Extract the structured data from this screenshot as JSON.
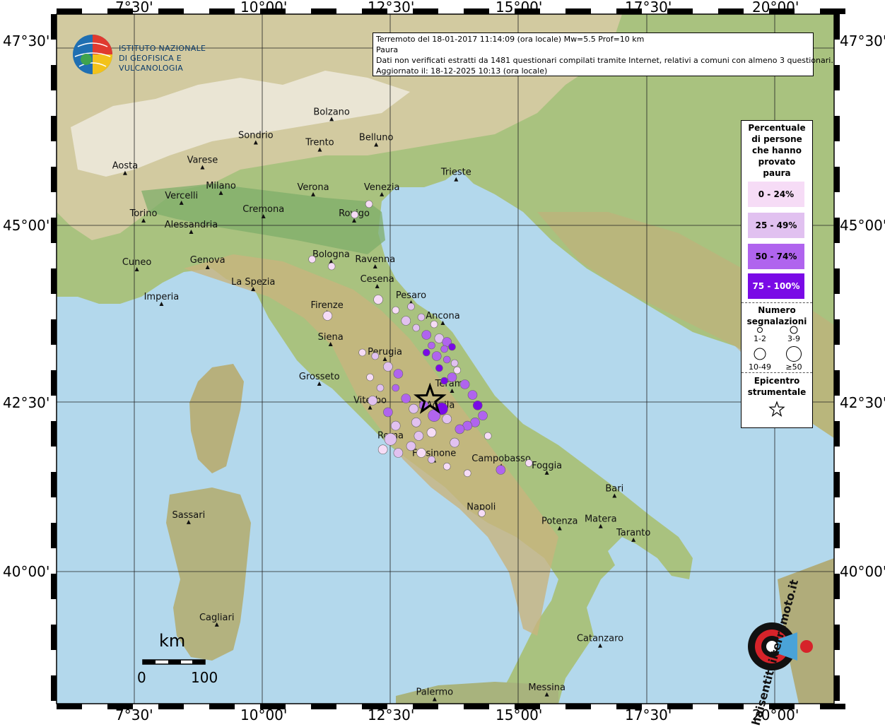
{
  "axes": {
    "lon": [
      "7°30'",
      "10°00'",
      "12°30'",
      "15°00'",
      "17°30'",
      "20°00'"
    ],
    "lat": [
      "47°30'",
      "45°00'",
      "42°30'",
      "40°00'"
    ]
  },
  "logo": {
    "line1": "ISTITUTO NAZIONALE",
    "line2": "DI GEOFISICA E VULCANOLOGIA",
    "haisentito": "haisentitoilterremoto.it"
  },
  "info": {
    "event": "Terremoto del 18-01-2017 11:14:09 (ora locale) Mw=5.5 Prof=10 km",
    "parameter": "Paura",
    "note": "Dati non verificati estratti da 1481 questionari compilati tramite Internet, relativi a comuni con almeno 3 questionari.",
    "updated": "Aggiornato il: 18-12-2025 10:13 (ora locale)"
  },
  "legend": {
    "title": [
      "Percentuale",
      "di persone",
      "che hanno",
      "provato",
      "paura"
    ],
    "classes": [
      {
        "label": "0 - 24%",
        "color": "#f6dcf6"
      },
      {
        "label": "25 - 49%",
        "color": "#e1c1f0"
      },
      {
        "label": "50 - 74%",
        "color": "#b064ee"
      },
      {
        "label": "75 - 100%",
        "color": "#7a0ae6"
      }
    ],
    "count_title": [
      "Numero",
      "segnalazioni"
    ],
    "sizes": [
      "1-2",
      "3-9",
      "10-49",
      "≥50"
    ],
    "epicenter_title": [
      "Epicentro",
      "strumentale"
    ]
  },
  "scale": {
    "unit": "km",
    "min": "0",
    "max": "100"
  },
  "cities": [
    {
      "name": "Bolzano",
      "lon": 11.35,
      "lat": 46.5
    },
    {
      "name": "Sondrio",
      "lon": 9.87,
      "lat": 46.17
    },
    {
      "name": "Belluno",
      "lon": 12.22,
      "lat": 46.14
    },
    {
      "name": "Trento",
      "lon": 11.12,
      "lat": 46.07
    },
    {
      "name": "Aosta",
      "lon": 7.32,
      "lat": 45.74
    },
    {
      "name": "Varese",
      "lon": 8.83,
      "lat": 45.82
    },
    {
      "name": "Trieste",
      "lon": 13.78,
      "lat": 45.65
    },
    {
      "name": "Milano",
      "lon": 9.19,
      "lat": 45.46
    },
    {
      "name": "Vercelli",
      "lon": 8.42,
      "lat": 45.32
    },
    {
      "name": "Verona",
      "lon": 10.99,
      "lat": 45.44
    },
    {
      "name": "Venezia",
      "lon": 12.33,
      "lat": 45.44
    },
    {
      "name": "Cremona",
      "lon": 10.02,
      "lat": 45.13
    },
    {
      "name": "Rovigo",
      "lon": 11.79,
      "lat": 45.07
    },
    {
      "name": "Torino",
      "lon": 7.68,
      "lat": 45.07
    },
    {
      "name": "Alessandria",
      "lon": 8.61,
      "lat": 44.91
    },
    {
      "name": "Bologna",
      "lon": 11.34,
      "lat": 44.49
    },
    {
      "name": "Ravenna",
      "lon": 12.2,
      "lat": 44.42
    },
    {
      "name": "Cuneo",
      "lon": 7.55,
      "lat": 44.38
    },
    {
      "name": "Genova",
      "lon": 8.93,
      "lat": 44.41
    },
    {
      "name": "La Spezia",
      "lon": 9.82,
      "lat": 44.1
    },
    {
      "name": "Cesena",
      "lon": 12.24,
      "lat": 44.14
    },
    {
      "name": "Pesaro",
      "lon": 12.9,
      "lat": 43.91
    },
    {
      "name": "Imperia",
      "lon": 8.03,
      "lat": 43.89
    },
    {
      "name": "Firenze",
      "lon": 11.26,
      "lat": 43.77
    },
    {
      "name": "Ancona",
      "lon": 13.52,
      "lat": 43.62
    },
    {
      "name": "Siena",
      "lon": 11.33,
      "lat": 43.32
    },
    {
      "name": "Perugia",
      "lon": 12.39,
      "lat": 43.11
    },
    {
      "name": "Grosseto",
      "lon": 11.11,
      "lat": 42.76
    },
    {
      "name": "Teramo",
      "lon": 13.7,
      "lat": 42.66
    },
    {
      "name": "Viterbo",
      "lon": 12.1,
      "lat": 42.42
    },
    {
      "name": "L'Aquila",
      "lon": 13.4,
      "lat": 42.35
    },
    {
      "name": "Roma",
      "lon": 12.5,
      "lat": 41.9
    },
    {
      "name": "Frosinone",
      "lon": 13.35,
      "lat": 41.64
    },
    {
      "name": "Campobasso",
      "lon": 14.66,
      "lat": 41.56
    },
    {
      "name": "Foggia",
      "lon": 15.55,
      "lat": 41.46
    },
    {
      "name": "Bari",
      "lon": 16.87,
      "lat": 41.12
    },
    {
      "name": "Sassari",
      "lon": 8.56,
      "lat": 40.73
    },
    {
      "name": "Napoli",
      "lon": 14.27,
      "lat": 40.85
    },
    {
      "name": "Potenza",
      "lon": 15.8,
      "lat": 40.64
    },
    {
      "name": "Matera",
      "lon": 16.6,
      "lat": 40.67
    },
    {
      "name": "Taranto",
      "lon": 17.24,
      "lat": 40.47
    },
    {
      "name": "Cagliari",
      "lon": 9.11,
      "lat": 39.22
    },
    {
      "name": "Catanzaro",
      "lon": 16.59,
      "lat": 38.91
    },
    {
      "name": "Palermo",
      "lon": 13.36,
      "lat": 38.12
    },
    {
      "name": "Messina",
      "lon": 15.55,
      "lat": 38.19
    }
  ],
  "epicenter": {
    "lon": 13.27,
    "lat": 42.53
  },
  "points": [
    {
      "lon": 12.08,
      "lat": 45.3,
      "c": 0,
      "s": 1
    },
    {
      "lon": 11.8,
      "lat": 45.15,
      "c": 0,
      "s": 1
    },
    {
      "lon": 10.97,
      "lat": 44.52,
      "c": 0,
      "s": 1
    },
    {
      "lon": 11.35,
      "lat": 44.42,
      "c": 0,
      "s": 1
    },
    {
      "lon": 12.26,
      "lat": 43.95,
      "c": 0,
      "s": 2
    },
    {
      "lon": 12.6,
      "lat": 43.8,
      "c": 0,
      "s": 1
    },
    {
      "lon": 11.27,
      "lat": 43.72,
      "c": 0,
      "s": 2
    },
    {
      "lon": 12.9,
      "lat": 43.85,
      "c": 1,
      "s": 1
    },
    {
      "lon": 13.1,
      "lat": 43.7,
      "c": 1,
      "s": 1
    },
    {
      "lon": 12.8,
      "lat": 43.65,
      "c": 1,
      "s": 2
    },
    {
      "lon": 13.35,
      "lat": 43.6,
      "c": 0,
      "s": 1
    },
    {
      "lon": 13.0,
      "lat": 43.55,
      "c": 1,
      "s": 1
    },
    {
      "lon": 13.2,
      "lat": 43.45,
      "c": 2,
      "s": 2
    },
    {
      "lon": 13.45,
      "lat": 43.4,
      "c": 1,
      "s": 2
    },
    {
      "lon": 13.6,
      "lat": 43.35,
      "c": 2,
      "s": 2
    },
    {
      "lon": 13.7,
      "lat": 43.28,
      "c": 3,
      "s": 1
    },
    {
      "lon": 13.55,
      "lat": 43.25,
      "c": 2,
      "s": 1
    },
    {
      "lon": 13.3,
      "lat": 43.3,
      "c": 2,
      "s": 1
    },
    {
      "lon": 13.2,
      "lat": 43.2,
      "c": 3,
      "s": 1
    },
    {
      "lon": 13.4,
      "lat": 43.15,
      "c": 2,
      "s": 2
    },
    {
      "lon": 13.6,
      "lat": 43.1,
      "c": 2,
      "s": 1
    },
    {
      "lon": 13.75,
      "lat": 43.05,
      "c": 1,
      "s": 1
    },
    {
      "lon": 13.45,
      "lat": 42.98,
      "c": 3,
      "s": 1
    },
    {
      "lon": 13.8,
      "lat": 42.95,
      "c": 0,
      "s": 1
    },
    {
      "lon": 13.7,
      "lat": 42.85,
      "c": 2,
      "s": 2
    },
    {
      "lon": 13.55,
      "lat": 42.8,
      "c": 3,
      "s": 1
    },
    {
      "lon": 13.95,
      "lat": 42.75,
      "c": 2,
      "s": 2
    },
    {
      "lon": 14.1,
      "lat": 42.6,
      "c": 2,
      "s": 2
    },
    {
      "lon": 14.2,
      "lat": 42.45,
      "c": 3,
      "s": 2
    },
    {
      "lon": 14.3,
      "lat": 42.3,
      "c": 2,
      "s": 2
    },
    {
      "lon": 14.15,
      "lat": 42.2,
      "c": 2,
      "s": 2
    },
    {
      "lon": 14.0,
      "lat": 42.15,
      "c": 2,
      "s": 2
    },
    {
      "lon": 13.85,
      "lat": 42.1,
      "c": 2,
      "s": 2
    },
    {
      "lon": 14.4,
      "lat": 42.0,
      "c": 0,
      "s": 1
    },
    {
      "lon": 13.5,
      "lat": 42.4,
      "c": 3,
      "s": 3
    },
    {
      "lon": 13.35,
      "lat": 42.3,
      "c": 2,
      "s": 3
    },
    {
      "lon": 13.6,
      "lat": 42.25,
      "c": 1,
      "s": 2
    },
    {
      "lon": 13.15,
      "lat": 42.45,
      "c": 2,
      "s": 2
    },
    {
      "lon": 12.95,
      "lat": 42.4,
      "c": 1,
      "s": 2
    },
    {
      "lon": 12.8,
      "lat": 42.55,
      "c": 2,
      "s": 2
    },
    {
      "lon": 12.6,
      "lat": 42.7,
      "c": 2,
      "s": 1
    },
    {
      "lon": 12.65,
      "lat": 42.9,
      "c": 2,
      "s": 2
    },
    {
      "lon": 12.45,
      "lat": 43.0,
      "c": 1,
      "s": 2
    },
    {
      "lon": 12.2,
      "lat": 43.15,
      "c": 1,
      "s": 1
    },
    {
      "lon": 11.95,
      "lat": 43.2,
      "c": 0,
      "s": 1
    },
    {
      "lon": 12.1,
      "lat": 42.85,
      "c": 0,
      "s": 1
    },
    {
      "lon": 12.3,
      "lat": 42.7,
      "c": 1,
      "s": 1
    },
    {
      "lon": 12.15,
      "lat": 42.52,
      "c": 1,
      "s": 2
    },
    {
      "lon": 12.45,
      "lat": 42.35,
      "c": 2,
      "s": 2
    },
    {
      "lon": 12.6,
      "lat": 42.15,
      "c": 1,
      "s": 2
    },
    {
      "lon": 12.5,
      "lat": 41.95,
      "c": 1,
      "s": 3
    },
    {
      "lon": 12.35,
      "lat": 41.8,
      "c": 0,
      "s": 2
    },
    {
      "lon": 12.65,
      "lat": 41.75,
      "c": 1,
      "s": 2
    },
    {
      "lon": 12.9,
      "lat": 41.85,
      "c": 1,
      "s": 2
    },
    {
      "lon": 13.1,
      "lat": 41.75,
      "c": 0,
      "s": 2
    },
    {
      "lon": 13.3,
      "lat": 41.65,
      "c": 1,
      "s": 1
    },
    {
      "lon": 13.6,
      "lat": 41.55,
      "c": 0,
      "s": 1
    },
    {
      "lon": 14.0,
      "lat": 41.45,
      "c": 0,
      "s": 1
    },
    {
      "lon": 14.65,
      "lat": 41.5,
      "c": 2,
      "s": 2
    },
    {
      "lon": 15.2,
      "lat": 41.6,
      "c": 0,
      "s": 1
    },
    {
      "lon": 14.28,
      "lat": 40.86,
      "c": 0,
      "s": 1
    },
    {
      "lon": 13.05,
      "lat": 42.0,
      "c": 1,
      "s": 2
    },
    {
      "lon": 13.0,
      "lat": 42.2,
      "c": 1,
      "s": 2
    },
    {
      "lon": 13.3,
      "lat": 42.05,
      "c": 0,
      "s": 2
    },
    {
      "lon": 13.75,
      "lat": 41.9,
      "c": 1,
      "s": 2
    }
  ]
}
